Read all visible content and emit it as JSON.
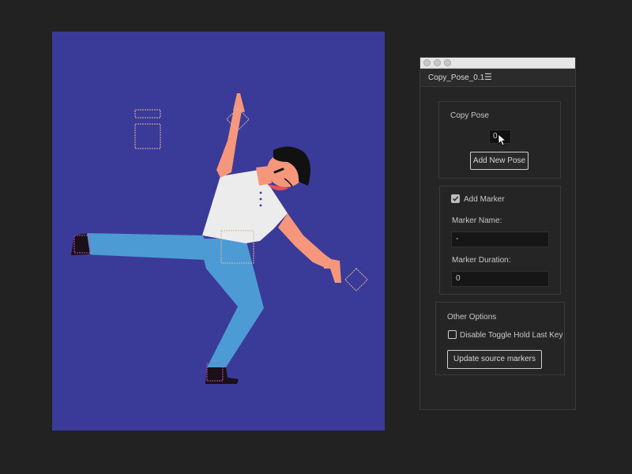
{
  "panel": {
    "tab_title": "Copy_Pose_0.1",
    "menu_icon": "hamburger-menu-icon",
    "copy_pose": {
      "section_label": "Copy Pose",
      "pose_value": "0",
      "add_button_label": "Add New Pose"
    },
    "marker": {
      "add_marker_label": "Add Marker",
      "add_marker_checked": true,
      "name_label": "Marker Name:",
      "name_value": "-",
      "duration_label": "Marker Duration:",
      "duration_value": "0"
    },
    "other_options": {
      "section_label": "Other Options",
      "toggle_label": "Disable Toggle Hold Last Key",
      "toggle_checked": false,
      "update_button_label": "Update source markers"
    }
  },
  "canvas": {
    "background_color": "#3a3a99",
    "skin_color": "#f6977b",
    "shirt_color": "#ececec",
    "pants_color": "#4d9bd4",
    "hair_color": "#111111"
  }
}
